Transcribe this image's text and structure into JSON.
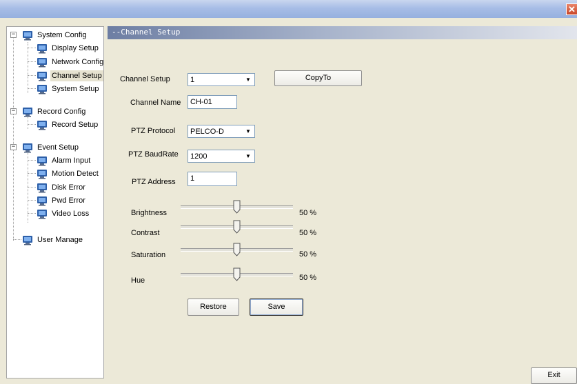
{
  "window": {
    "close_glyph": "✕"
  },
  "tree": {
    "items": [
      {
        "label": "System Config"
      },
      {
        "label": "Display Setup"
      },
      {
        "label": "Network Config"
      },
      {
        "label": "Channel Setup"
      },
      {
        "label": "System Setup"
      },
      {
        "label": "Record Config"
      },
      {
        "label": "Record Setup"
      },
      {
        "label": "Event Setup"
      },
      {
        "label": "Alarm Input"
      },
      {
        "label": "Motion Detect"
      },
      {
        "label": "Disk Error"
      },
      {
        "label": "Pwd Error"
      },
      {
        "label": "Video Loss"
      },
      {
        "label": "User Manage"
      }
    ],
    "expander_glyph": "−",
    "selected": "Channel Setup"
  },
  "panel": {
    "title": "--Channel Setup"
  },
  "form": {
    "channel_label": "Channel Setup",
    "channel_value": "1",
    "copyto_label": "CopyTo",
    "name_label": "Channel Name",
    "name_value": "CH-01",
    "ptz_protocol_label": "PTZ Protocol",
    "ptz_protocol_value": "PELCO-D",
    "ptz_baud_label": "PTZ BaudRate",
    "ptz_baud_value": "1200",
    "ptz_address_label": "PTZ Address",
    "ptz_address_value": "1",
    "dropdown_glyph": "▼"
  },
  "sliders": [
    {
      "label": "Brightness",
      "percent": "50 %",
      "level": 0.5
    },
    {
      "label": "Contrast",
      "percent": "50 %",
      "level": 0.5
    },
    {
      "label": "Saturation",
      "percent": "50 %",
      "level": 0.5
    },
    {
      "label": "Hue",
      "percent": "50 %",
      "level": 0.5
    }
  ],
  "buttons": {
    "restore": "Restore",
    "save": "Save",
    "exit": "Exit"
  }
}
